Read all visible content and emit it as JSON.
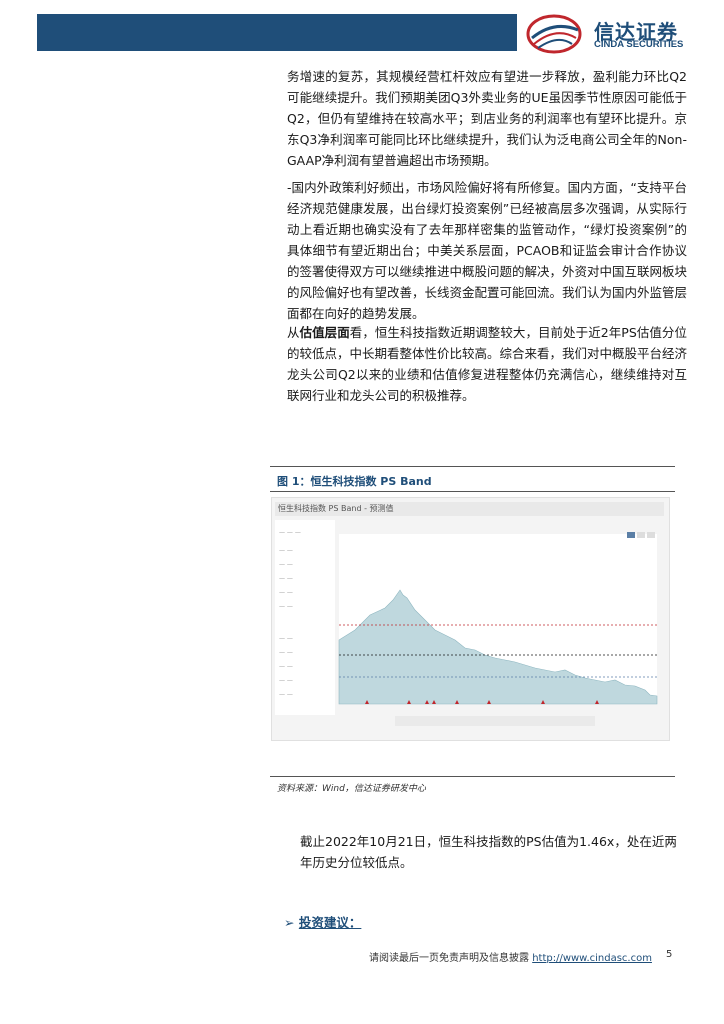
{
  "header": {
    "brand_cn": "信达证券",
    "brand_en": "CINDA SECURITIES",
    "bar_color": "#1f4e79"
  },
  "body": {
    "para1": "务增速的复苏，其规模经营杠杆效应有望进一步释放，盈利能力环比Q2可能继续提升。我们预期美团Q3外卖业务的UE虽因季节性原因可能低于Q2，但仍有望维持在较高水平；到店业务的利润率也有望环比提升。京东Q3净利润率可能同比环比继续提升，我们认为泛电商公司全年的Non-GAAP净利润有望普遍超出市场预期。",
    "para2": "-国内外政策利好频出，市场风险偏好将有所修复。国内方面，“支持平台经济规范健康发展，出台绿灯投资案例”已经被高层多次强调，从实际行动上看近期也确实没有了去年那样密集的监管动作，“绿灯投资案例”的具体细节有望近期出台；中美关系层面，PCAOB和证监会审计合作协议的签署使得双方可以继续推进中概股问题的解决，外资对中国互联网板块的风险偏好也有望改善，长线资金配置可能回流。我们认为国内外监管层面都在向好的趋势发展。",
    "para3_prefix": "从",
    "para3_bold": "估值层面",
    "para3_rest": "看，恒生科技指数近期调整较大，目前处于近2年PS估值分位的较低点，中长期看整体性价比较高。综合来看，我们对中概股平台经济龙头公司Q2以来的业绩和估值修复进程整体仍充满信心，继续维持对互联网行业和龙头公司的积极推荐。"
  },
  "figure": {
    "caption": "图 1：恒生科技指数 PS Band",
    "chart_title": "恒生科技指数 PS Band - 预测值",
    "source": "资料来源：Wind，信达证券研发中心"
  },
  "bottom": {
    "para": "截止2022年10月21日，恒生科技指数的PS估值为1.46x，处在近两年历史分位较低点。",
    "invest_arrow": "➢",
    "invest_label": "投资建议："
  },
  "footer": {
    "text": "请阅读最后一页免责声明及信息披露",
    "link": "http://www.cindasc.com",
    "page": "5"
  }
}
